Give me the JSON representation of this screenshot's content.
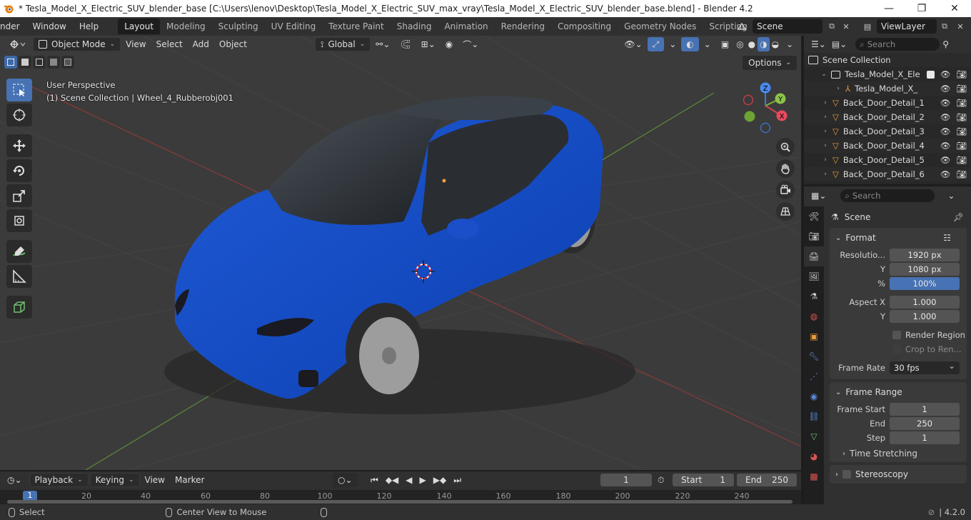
{
  "window": {
    "title": "* Tesla_Model_X_Electric_SUV_blender_base [C:\\Users\\lenov\\Desktop\\Tesla_Model_X_Electric_SUV_max_vray\\Tesla_Model_X_Electric_SUV_blender_base.blend] - Blender 4.2"
  },
  "menu": [
    "nder",
    "Window",
    "Help"
  ],
  "workspaces": [
    "Layout",
    "Modeling",
    "Sculpting",
    "UV Editing",
    "Texture Paint",
    "Shading",
    "Animation",
    "Rendering",
    "Compositing",
    "Geometry Nodes",
    "Scripting"
  ],
  "scene_name": "Scene",
  "view_layer": "ViewLayer",
  "viewport": {
    "mode": "Object Mode",
    "menus": [
      "View",
      "Select",
      "Add",
      "Object"
    ],
    "orientation": "Global",
    "options_label": "Options",
    "info_line1": "User Perspective",
    "info_line2": "(1) Scene Collection | Wheel_4_Rubberobj001",
    "gizmo": {
      "x": "X",
      "y": "Y",
      "z": "Z"
    }
  },
  "outliner": {
    "search_placeholder": "Search",
    "rows": [
      "Scene Collection",
      "Tesla_Model_X_Ele",
      "Tesla_Model_X_",
      "Back_Door_Detail_1",
      "Back_Door_Detail_2",
      "Back_Door_Detail_3",
      "Back_Door_Detail_4",
      "Back_Door_Detail_5",
      "Back_Door_Detail_6"
    ]
  },
  "properties": {
    "search_placeholder": "Search",
    "context": "Scene",
    "format": {
      "title": "Format",
      "resolution_x_label": "Resolutio...",
      "resolution_x": "1920 px",
      "resolution_y_label": "Y",
      "resolution_y": "1080 px",
      "percent_label": "%",
      "percent": "100%",
      "aspect_x_label": "Aspect X",
      "aspect_x": "1.000",
      "aspect_y_label": "Y",
      "aspect_y": "1.000",
      "render_region": "Render Region",
      "crop": "Crop to Ren...",
      "frame_rate_label": "Frame Rate",
      "frame_rate": "30 fps"
    },
    "frame_range": {
      "title": "Frame Range",
      "start_label": "Frame Start",
      "start": "1",
      "end_label": "End",
      "end": "250",
      "step_label": "Step",
      "step": "1",
      "time_stretching": "Time Stretching"
    },
    "stereoscopy": "Stereoscopy"
  },
  "timeline": {
    "menus": [
      "Playback",
      "Keying",
      "View",
      "Marker"
    ],
    "current_frame": "1",
    "start_label": "Start",
    "start": "1",
    "end_label": "End",
    "end": "250",
    "ruler_current": "1",
    "ticks": [
      "20",
      "40",
      "60",
      "80",
      "100",
      "120",
      "140",
      "160",
      "180",
      "200",
      "220",
      "240"
    ]
  },
  "statusbar": {
    "select": "Select",
    "center_view": "Center View to Mouse",
    "version": "4.2.0"
  }
}
